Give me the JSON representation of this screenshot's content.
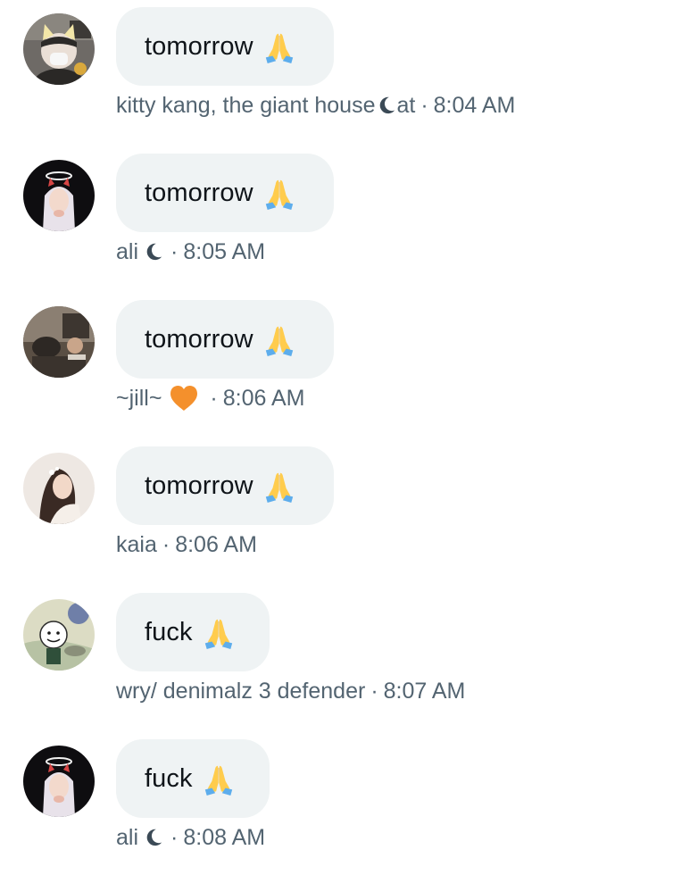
{
  "messages": [
    {
      "text": "tomorrow",
      "emoji": "folded-hands",
      "author": "kitty kang, the giant house",
      "author_icon": "crescent-moon",
      "author_suffix": "at",
      "separator": "·",
      "time": "8:04 AM",
      "avatar": "cat-ears-mask-person"
    },
    {
      "text": "tomorrow",
      "emoji": "folded-hands",
      "author": "ali",
      "author_icon": "crescent-moon",
      "separator": "·",
      "time": "8:05 AM",
      "avatar": "halo-devil-horns-girl"
    },
    {
      "text": "tomorrow",
      "emoji": "folded-hands",
      "author": "~jill~",
      "author_icon": "orange-heart",
      "separator": "·",
      "time": "8:06 AM",
      "avatar": "dark-photo-people"
    },
    {
      "text": "tomorrow",
      "emoji": "folded-hands",
      "author": "kaia",
      "separator": "·",
      "time": "8:06 AM",
      "avatar": "woman-portrait"
    },
    {
      "text": "fuck",
      "emoji": "folded-hands",
      "author": "wry/ denimalz 3 defender",
      "separator": "·",
      "time": "8:07 AM",
      "avatar": "cartoon-character"
    },
    {
      "text": "fuck",
      "emoji": "folded-hands",
      "author": "ali",
      "author_icon": "crescent-moon",
      "separator": "·",
      "time": "8:08 AM",
      "avatar": "halo-devil-horns-girl"
    }
  ],
  "colors": {
    "bubble_bg": "#eff3f4",
    "text_primary": "#0f1419",
    "text_secondary": "#536471",
    "heart": "#f4902c"
  }
}
